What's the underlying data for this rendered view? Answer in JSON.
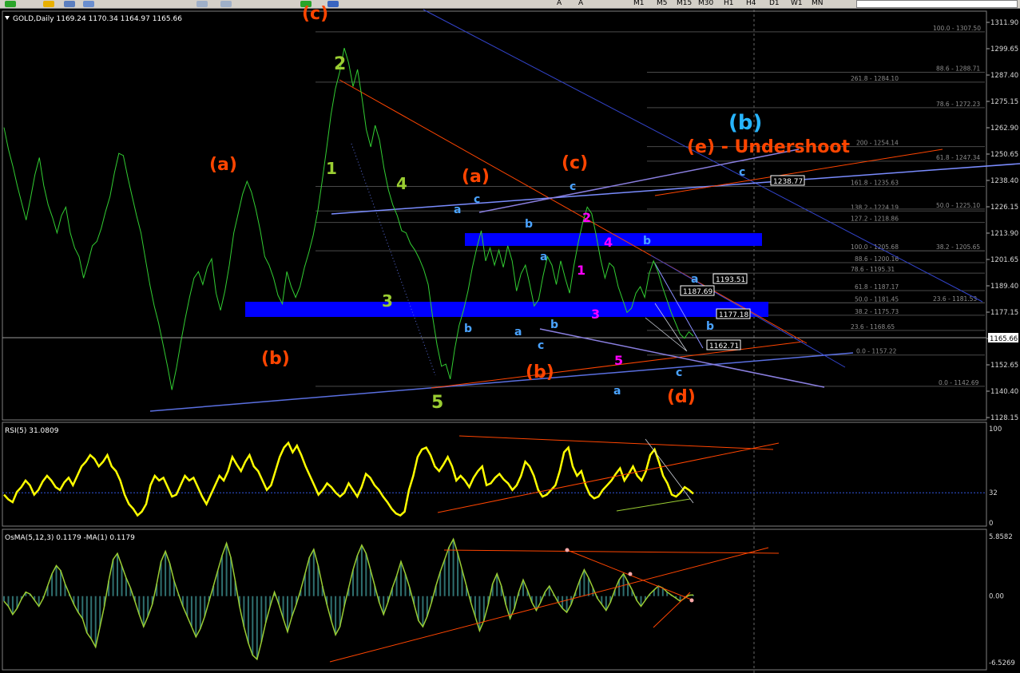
{
  "toolbar": {
    "timeframes": [
      "M1",
      "M5",
      "M15",
      "M30",
      "H1",
      "H4",
      "D1",
      "W1",
      "MN"
    ],
    "tool_letters": [
      "A",
      "A"
    ]
  },
  "colors": {
    "background": "#000000",
    "price_line": "#32cd32",
    "rsi_line": "#ffff00",
    "osma_hist": "#2f6f6f",
    "osma_signal": "#9acd32",
    "zone": "#0000ff",
    "trend_blue": "#6a7fd6",
    "trend_red": "#ff4500",
    "fib_level": "#555555",
    "label_red": "#ff4500",
    "label_green": "#9acd32",
    "label_blue": "#4aa3ff",
    "label_cyan": "#27b5ff",
    "label_magenta": "#ff00ff"
  },
  "chart_data": [
    {
      "type": "line",
      "title": "GOLD,Daily  1169.24 1170.34 1164.97 1165.66",
      "symbol": "GOLD",
      "timeframe": "Daily",
      "ohlc": {
        "open": 1169.24,
        "high": 1170.34,
        "low": 1164.97,
        "close": 1165.66
      },
      "current_price": "1165.66",
      "ylim": [
        1124,
        1316
      ],
      "y_ticks": [
        "1311.90",
        "1299.65",
        "1287.40",
        "1275.15",
        "1262.90",
        "1250.65",
        "1238.40",
        "1226.15",
        "1213.90",
        "1201.65",
        "1189.40",
        "1177.15",
        "1164.90",
        "1152.65",
        "1140.40",
        "1128.15"
      ],
      "grid": false,
      "series": [
        {
          "values": [
            1263,
            1253,
            1245,
            1236,
            1228,
            1220,
            1230,
            1241,
            1249,
            1236,
            1227,
            1221,
            1214,
            1222,
            1226,
            1214,
            1207,
            1203,
            1193,
            1200,
            1208,
            1210,
            1216,
            1224,
            1231,
            1242,
            1251,
            1250,
            1240,
            1231,
            1222,
            1214,
            1202,
            1190,
            1180,
            1172,
            1162,
            1152,
            1141,
            1151,
            1163,
            1174,
            1184,
            1193,
            1196,
            1190,
            1198,
            1202,
            1186,
            1178,
            1187,
            1199,
            1214,
            1223,
            1232,
            1238,
            1233,
            1225,
            1215,
            1203,
            1199,
            1193,
            1185,
            1181,
            1196,
            1189,
            1184,
            1189,
            1198,
            1205,
            1213,
            1224,
            1238,
            1253,
            1269,
            1281,
            1289,
            1300,
            1293,
            1282,
            1290,
            1277,
            1262,
            1254,
            1264,
            1257,
            1244,
            1234,
            1227,
            1222,
            1215,
            1214,
            1209,
            1206,
            1202,
            1197,
            1190,
            1175,
            1162,
            1152,
            1153,
            1146,
            1160,
            1171,
            1178,
            1187,
            1198,
            1207,
            1215,
            1201,
            1207,
            1199,
            1206,
            1198,
            1208,
            1201,
            1187,
            1195,
            1199,
            1190,
            1180,
            1183,
            1194,
            1203,
            1199,
            1190,
            1201,
            1193,
            1186,
            1199,
            1210,
            1219,
            1226,
            1223,
            1213,
            1202,
            1193,
            1200,
            1198,
            1189,
            1183,
            1177,
            1179,
            1186,
            1189,
            1184,
            1195,
            1201,
            1196,
            1189,
            1183,
            1177,
            1172,
            1167,
            1165,
            1168,
            1166
          ]
        }
      ],
      "fib_levels": [
        {
          "label": "100.0 - 1307.50"
        },
        {
          "label": "88.6 - 1288.71"
        },
        {
          "label": "261.8 - 1284.10"
        },
        {
          "label": "78.6 - 1272.23"
        },
        {
          "label": "200 - 1254.14"
        },
        {
          "label": "61.8 - 1247.34"
        },
        {
          "label": "161.8 - 1235.63"
        },
        {
          "label": "138.2 - 1224.19"
        },
        {
          "label": "50.0 - 1225.10"
        },
        {
          "label": "127.2 - 1218.86"
        },
        {
          "label": "100.0 - 1205.68"
        },
        {
          "label": "38.2 - 1205.65"
        },
        {
          "label": "88.6 - 1200.16"
        },
        {
          "label": "78.6 - 1195.31"
        },
        {
          "label": "61.8 - 1187.17"
        },
        {
          "label": "50.0 - 1181.45"
        },
        {
          "label": "23.6 - 1181.53"
        },
        {
          "label": "38.2 - 1175.73"
        },
        {
          "label": "23.6 - 1168.65"
        },
        {
          "label": "0.0 - 1157.22"
        },
        {
          "label": "0.0 - 1142.69"
        }
      ],
      "price_tags": [
        "1238.77",
        "1193.51",
        "1187.69",
        "1177.18",
        "1162.71"
      ],
      "wave_labels": [
        {
          "text": "(c)",
          "color": "red"
        },
        {
          "text": "(a)",
          "color": "red"
        },
        {
          "text": "(b)",
          "color": "red"
        },
        {
          "text": "2",
          "color": "green"
        },
        {
          "text": "1",
          "color": "green"
        },
        {
          "text": "4",
          "color": "green"
        },
        {
          "text": "3",
          "color": "green"
        },
        {
          "text": "5",
          "color": "green"
        },
        {
          "text": "(a)",
          "color": "red"
        },
        {
          "text": "(c)",
          "color": "red"
        },
        {
          "text": "(b)",
          "color": "red"
        },
        {
          "text": "(d)",
          "color": "red"
        },
        {
          "text": "(e) - Undershoot",
          "color": "red"
        },
        {
          "text": "(b)",
          "color": "cyan"
        },
        {
          "text": "c",
          "color": "blue"
        },
        {
          "text": "a",
          "color": "blue"
        },
        {
          "text": "c",
          "color": "blue"
        },
        {
          "text": "b",
          "color": "blue"
        },
        {
          "text": "a",
          "color": "blue"
        },
        {
          "text": "b",
          "color": "blue"
        },
        {
          "text": "b",
          "color": "blue"
        },
        {
          "text": "a",
          "color": "blue"
        },
        {
          "text": "b",
          "color": "blue"
        },
        {
          "text": "c",
          "color": "blue"
        },
        {
          "text": "a",
          "color": "blue"
        },
        {
          "text": "b",
          "color": "blue"
        },
        {
          "text": "c",
          "color": "blue"
        },
        {
          "text": "a",
          "color": "blue"
        },
        {
          "text": "c",
          "color": "blue"
        },
        {
          "text": "2",
          "color": "magenta"
        },
        {
          "text": "4",
          "color": "magenta"
        },
        {
          "text": "1",
          "color": "magenta"
        },
        {
          "text": "3",
          "color": "magenta"
        },
        {
          "text": "5",
          "color": "magenta"
        }
      ]
    },
    {
      "type": "line",
      "title": "RSI(5) 31.0809",
      "indicator": "RSI",
      "period": 5,
      "current_value": 31.0809,
      "ylim": [
        0,
        100
      ],
      "y_ticks": [
        "100",
        "32",
        "0"
      ],
      "reference_level": 32,
      "series": [
        {
          "values": [
            30,
            25,
            22,
            33,
            38,
            45,
            40,
            30,
            35,
            44,
            50,
            45,
            38,
            35,
            43,
            48,
            40,
            50,
            60,
            65,
            72,
            68,
            60,
            65,
            72,
            60,
            55,
            45,
            30,
            20,
            15,
            8,
            12,
            20,
            40,
            50,
            45,
            48,
            38,
            28,
            30,
            40,
            50,
            45,
            48,
            38,
            28,
            20,
            30,
            40,
            50,
            45,
            55,
            70,
            62,
            55,
            65,
            72,
            60,
            55,
            45,
            35,
            40,
            55,
            70,
            80,
            85,
            75,
            82,
            72,
            60,
            50,
            40,
            30,
            35,
            42,
            38,
            32,
            28,
            32,
            42,
            35,
            28,
            38,
            52,
            48,
            40,
            35,
            28,
            22,
            15,
            10,
            8,
            12,
            35,
            50,
            70,
            78,
            80,
            72,
            60,
            55,
            62,
            70,
            60,
            45,
            50,
            45,
            38,
            48,
            55,
            60,
            40,
            42,
            48,
            52,
            46,
            42,
            35,
            40,
            50,
            65,
            60,
            50,
            35,
            28,
            30,
            35,
            40,
            55,
            75,
            80,
            60,
            50,
            55,
            40,
            30,
            26,
            28,
            35,
            40,
            45,
            52,
            58,
            45,
            52,
            60,
            50,
            45,
            55,
            72,
            78,
            65,
            50,
            42,
            30,
            28,
            32,
            38,
            35,
            31
          ]
        }
      ]
    },
    {
      "type": "bar",
      "title": "OsMA(5,12,3) 0.1179  -MA(1) 0.1179",
      "indicator": "OsMA",
      "params": [
        5,
        12,
        3
      ],
      "current_value": 0.1179,
      "signal_ma": "MA(1)",
      "signal_value": 0.1179,
      "ylim": [
        -6.5269,
        5.8582
      ],
      "y_ticks": [
        "5.8582",
        "0.00",
        "-6.5269"
      ],
      "series": [
        {
          "values": [
            -0.5,
            -1.0,
            -1.8,
            -1.2,
            -0.3,
            0.4,
            0.2,
            -0.4,
            -1.0,
            -0.2,
            1.0,
            2.2,
            3.0,
            2.5,
            1.2,
            0.2,
            -0.8,
            -1.6,
            -2.2,
            -3.6,
            -4.2,
            -5.0,
            -3.0,
            -1.0,
            1.5,
            3.6,
            4.2,
            3.0,
            1.8,
            0.8,
            -0.5,
            -1.8,
            -3.0,
            -2.0,
            -0.8,
            1.2,
            3.4,
            4.4,
            3.2,
            1.5,
            0.2,
            -1.0,
            -2.0,
            -3.0,
            -4.0,
            -3.2,
            -2.0,
            -0.5,
            1.0,
            2.5,
            4.0,
            5.2,
            3.8,
            1.5,
            -1.0,
            -3.0,
            -4.6,
            -5.8,
            -6.2,
            -4.5,
            -2.6,
            -1.0,
            0.4,
            -0.8,
            -2.2,
            -3.5,
            -2.0,
            -0.8,
            0.6,
            2.2,
            3.8,
            4.6,
            3.0,
            1.0,
            -0.8,
            -2.4,
            -3.8,
            -3.0,
            -1.0,
            0.8,
            2.6,
            4.0,
            5.0,
            4.2,
            2.6,
            1.0,
            -0.6,
            -1.8,
            -0.6,
            0.8,
            2.0,
            3.4,
            2.2,
            0.8,
            -0.8,
            -2.4,
            -3.0,
            -2.0,
            -0.6,
            1.0,
            2.4,
            3.6,
            4.8,
            5.6,
            4.2,
            2.6,
            1.0,
            -0.6,
            -2.0,
            -3.4,
            -2.4,
            -0.8,
            1.2,
            2.2,
            1.0,
            -0.8,
            -2.2,
            -1.2,
            0.4,
            1.6,
            0.6,
            -0.6,
            -1.4,
            -0.6,
            0.4,
            1.0,
            0.2,
            -0.6,
            -1.2,
            -1.6,
            -0.8,
            0.4,
            1.6,
            2.6,
            1.8,
            0.8,
            -0.2,
            -0.8,
            -1.4,
            -0.6,
            0.6,
            1.6,
            2.2,
            1.4,
            0.6,
            -0.4,
            -1.0,
            -0.4,
            0.2,
            0.6,
            1.0,
            0.8,
            0.4,
            0.1,
            -0.2,
            -0.5,
            -0.2,
            0.1,
            0.1179
          ]
        }
      ]
    }
  ]
}
